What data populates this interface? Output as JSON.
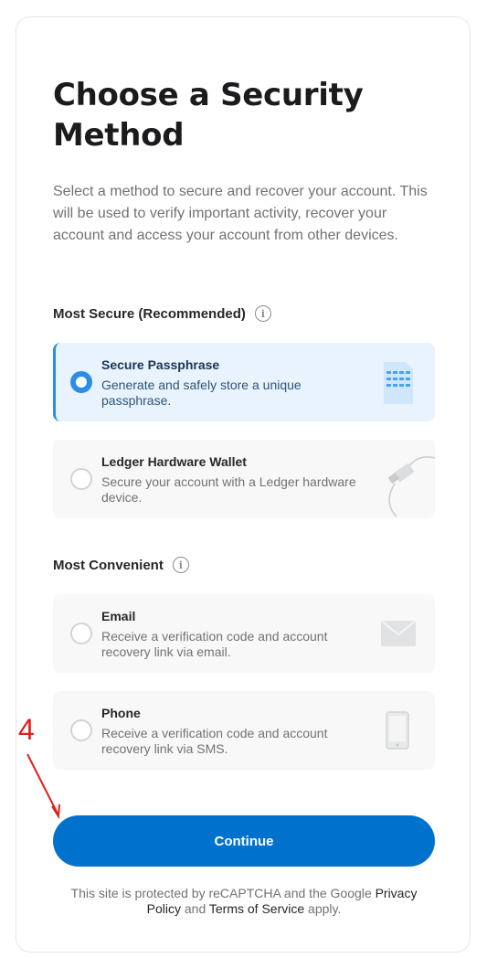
{
  "title": "Choose a Security Method",
  "description": "Select a method to secure and recover your account. This will be used to verify important activity, recover your account and access your account from other devices.",
  "sections": {
    "secure": {
      "label": "Most Secure (Recommended)",
      "options": [
        {
          "title": "Secure Passphrase",
          "desc": "Generate and safely store a unique passphrase.",
          "selected": true,
          "icon": "passphrase-doc-icon"
        },
        {
          "title": "Ledger Hardware Wallet",
          "desc": "Secure your account with a Ledger hardware device.",
          "selected": false,
          "icon": "ledger-usb-icon"
        }
      ]
    },
    "convenient": {
      "label": "Most Convenient",
      "options": [
        {
          "title": "Email",
          "desc": "Receive a verification code and account recovery link via email.",
          "selected": false,
          "icon": "envelope-icon"
        },
        {
          "title": "Phone",
          "desc": "Receive a verification code and account recovery link via SMS.",
          "selected": false,
          "icon": "phone-icon"
        }
      ]
    }
  },
  "continue_label": "Continue",
  "footer": {
    "prefix": "This site is protected by reCAPTCHA and the Google ",
    "privacy": "Privacy Policy",
    "middle": " and ",
    "terms": "Terms of Service",
    "suffix": " apply."
  },
  "annotation": {
    "number": "4",
    "color": "#e0201b"
  },
  "colors": {
    "accent": "#0072ce",
    "selected_bg": "#e8f3fd",
    "radio_selected": "#2b8de8"
  }
}
